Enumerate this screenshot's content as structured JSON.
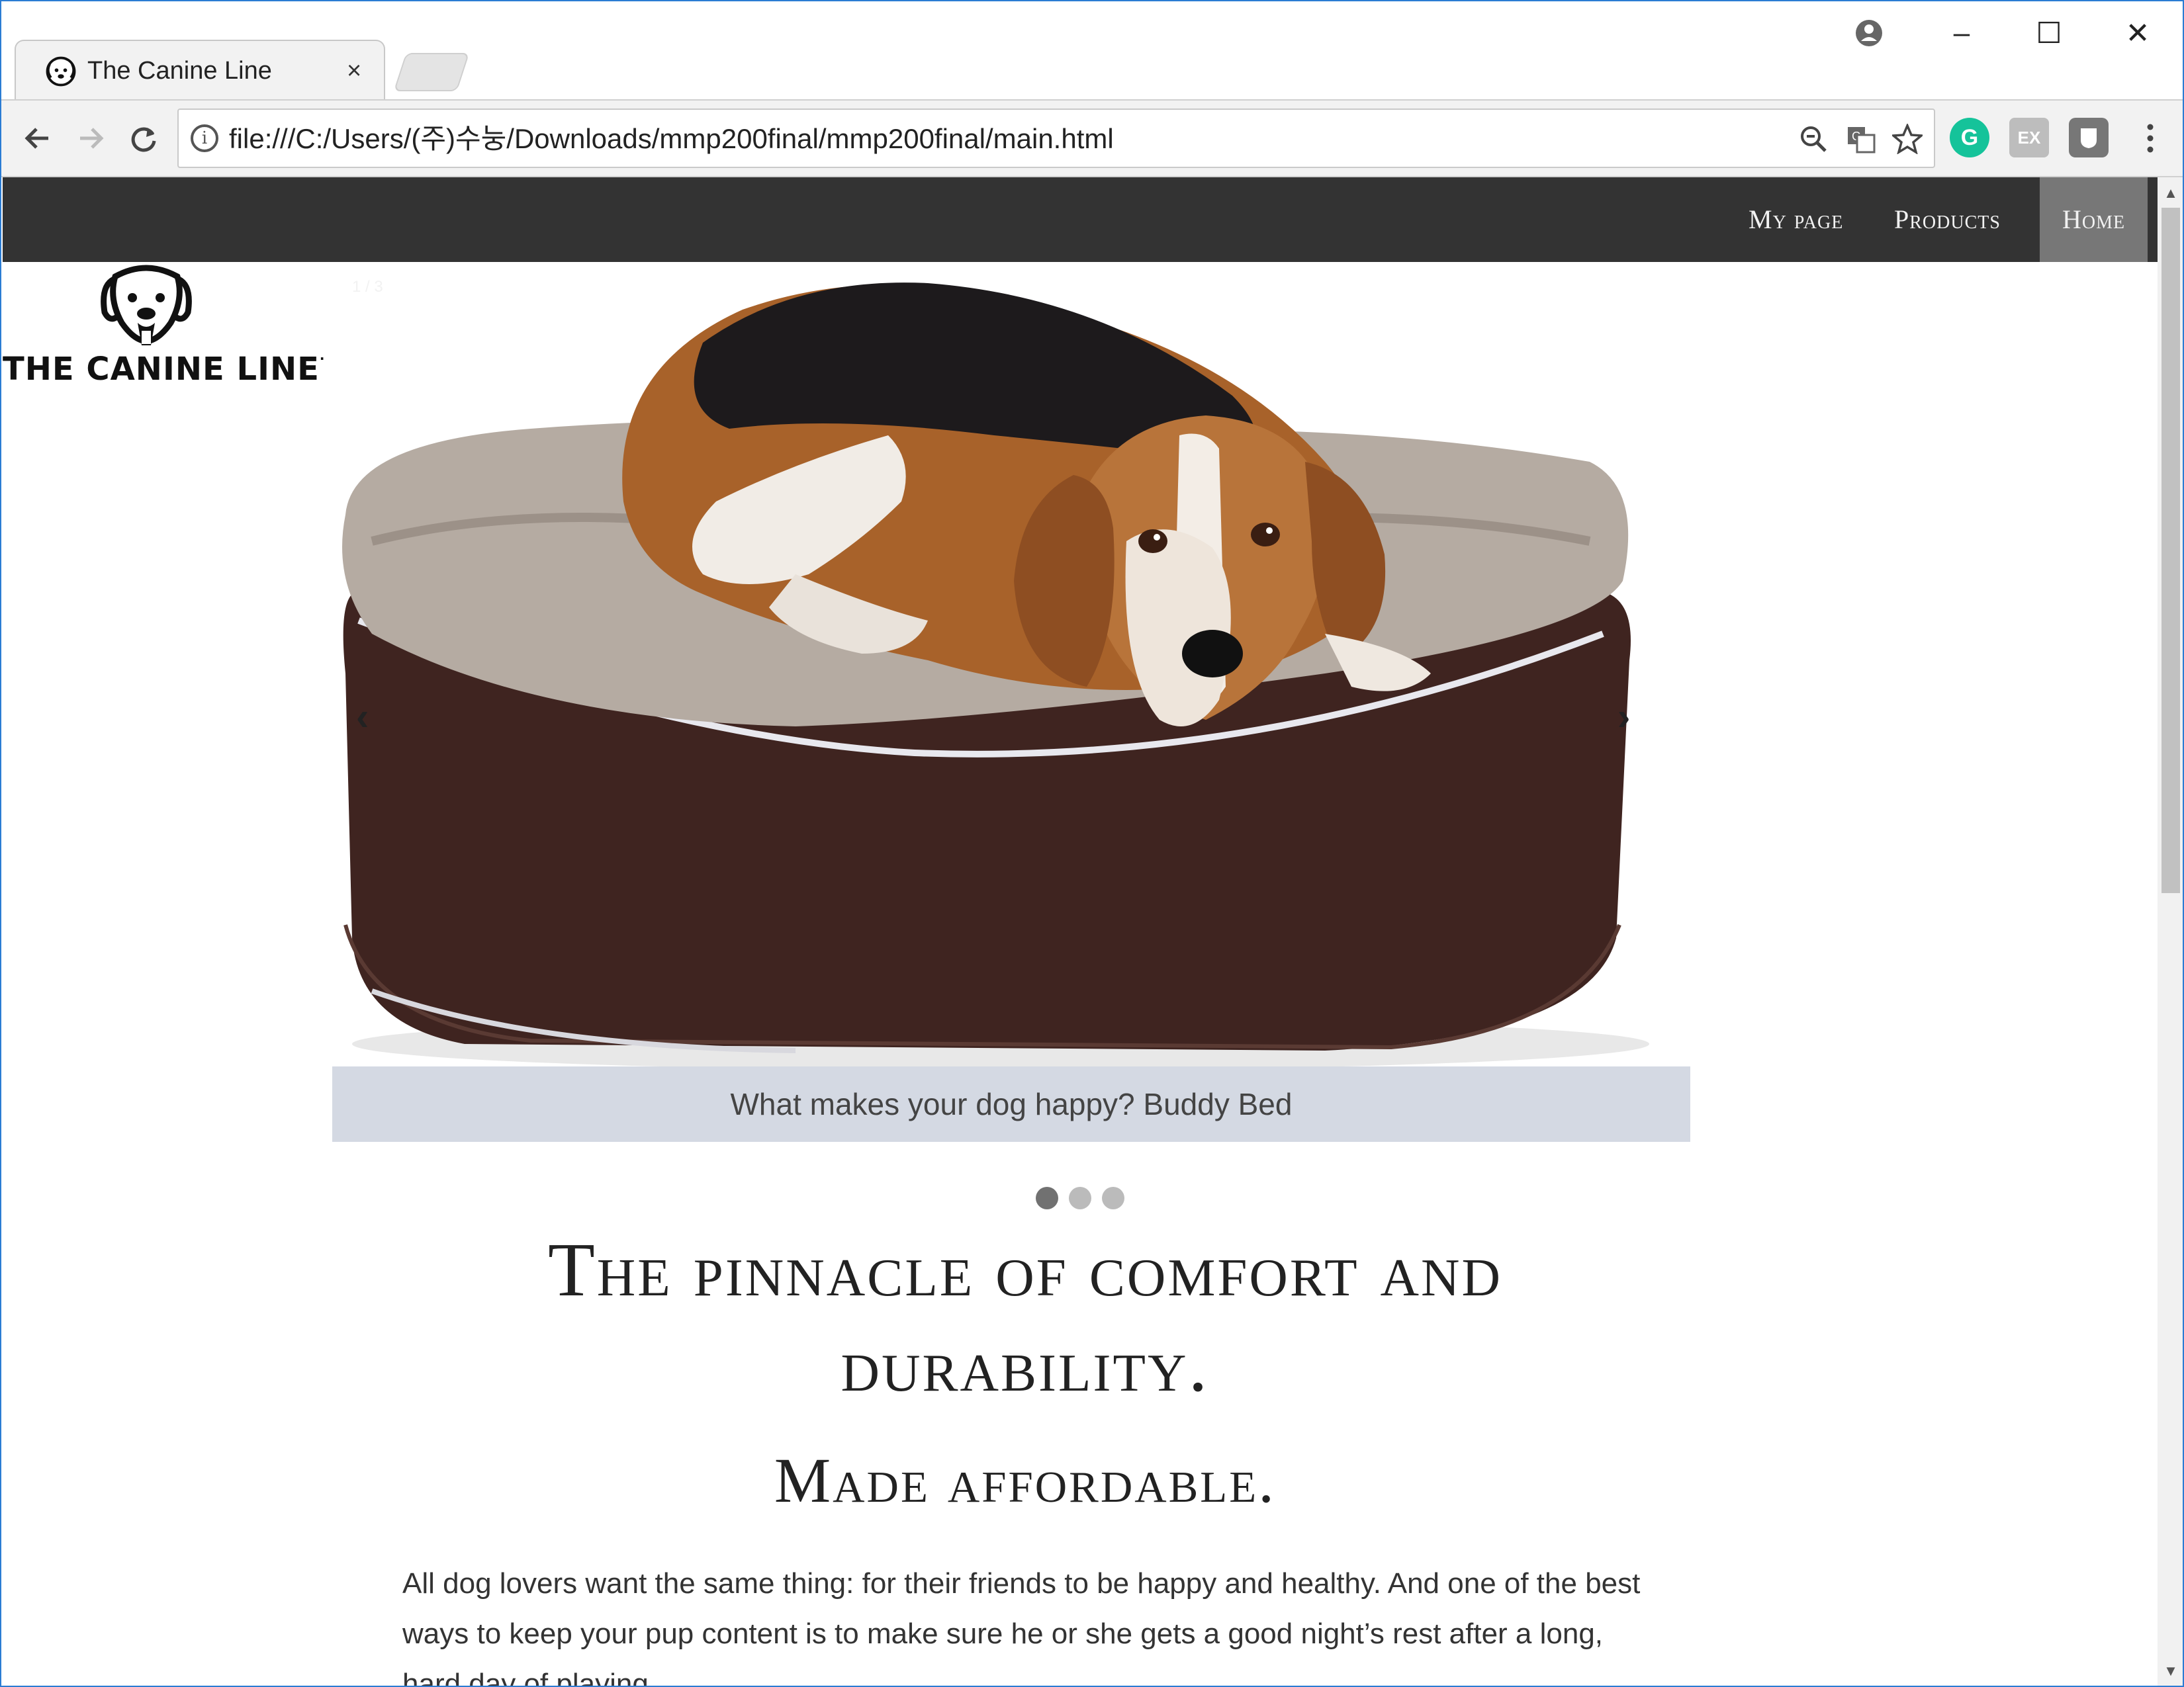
{
  "browser": {
    "tab_title": "The Canine Line",
    "tab_close": "×",
    "url": "file:///C:/Users/(주)수눙/Downloads/mmp200final/mmp200final/main.html",
    "window_controls": {
      "minimize": "–",
      "maximize": "☐",
      "close": "✕"
    },
    "icons": [
      "account-icon",
      "back-icon",
      "forward-icon",
      "reload-icon",
      "info-icon",
      "zoom-icon",
      "translate-icon",
      "star-icon",
      "grammarly-icon",
      "extension-icon",
      "shield-extension-icon",
      "menu-icon"
    ],
    "ext_labels": {
      "grammarly": "G",
      "ex": "EX"
    }
  },
  "site": {
    "nav": [
      {
        "label": "My page"
      },
      {
        "label": "Products"
      },
      {
        "label": "Home",
        "active": true
      }
    ],
    "brand": "THE CANINE LINE",
    "brand_mark": "·",
    "slideshow": {
      "counter": "1 / 3",
      "caption": "What makes your dog happy? Buddy Bed",
      "prev": "‹",
      "next": "›",
      "dots": 3,
      "active_dot": 0
    },
    "headline_line1": "The pinnacle of comfort and",
    "headline_line2": "durability.",
    "subhead": "Made affordable.",
    "body": "All dog lovers want the same thing: for their friends to be happy and healthy. And one of the best ways to keep your pup content is to make sure he or she gets a good night’s rest after a long, hard day of playing."
  },
  "colors": {
    "nav_bg": "#333333",
    "nav_active": "#777777",
    "caption_bg": "#d4d9e3",
    "bed_brown": "#3f2420",
    "fur_gray": "#b5aba2"
  }
}
